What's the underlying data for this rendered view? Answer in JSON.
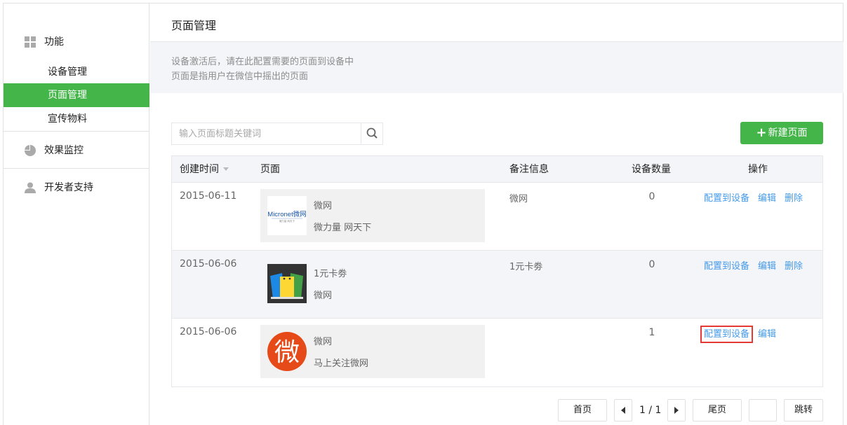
{
  "sidebar": {
    "function_label": "功能",
    "items": [
      {
        "label": "设备管理"
      },
      {
        "label": "页面管理"
      },
      {
        "label": "宣传物料"
      }
    ],
    "monitor_label": "效果监控",
    "developer_label": "开发者支持"
  },
  "page": {
    "title": "页面管理",
    "notice_line1": "设备激活后，请在此配置需要的页面到设备中",
    "notice_line2": "页面是指用户在微信中摇出的页面"
  },
  "search": {
    "placeholder": "输入页面标题关键词"
  },
  "new_button_label": "新建页面",
  "table": {
    "headers": {
      "created": "创建时间",
      "page": "页面",
      "remark": "备注信息",
      "device_count": "设备数量",
      "actions": "操作"
    },
    "rows": [
      {
        "date": "2015-06-11",
        "title": "微网",
        "desc": "微力量 网天下",
        "remark": "微网",
        "count": "0",
        "thumb_brand": "Micronet微网",
        "thumb_tagline": "微力量 网天下"
      },
      {
        "date": "2015-06-06",
        "title": "1元卡劵",
        "desc": "微网",
        "remark": "1元卡劵",
        "count": "0"
      },
      {
        "date": "2015-06-06",
        "title": "微网",
        "desc": "马上关注微网",
        "remark": "",
        "count": "1",
        "thumb_char": "微"
      }
    ],
    "actions": {
      "configure": "配置到设备",
      "edit": "编辑",
      "delete": "删除"
    }
  },
  "pagination": {
    "first": "首页",
    "page_info": "1 / 1",
    "last": "尾页",
    "jump": "跳转"
  },
  "colors": {
    "accent": "#44b549",
    "link": "#459ae9",
    "highlight_box": "#e53935"
  }
}
